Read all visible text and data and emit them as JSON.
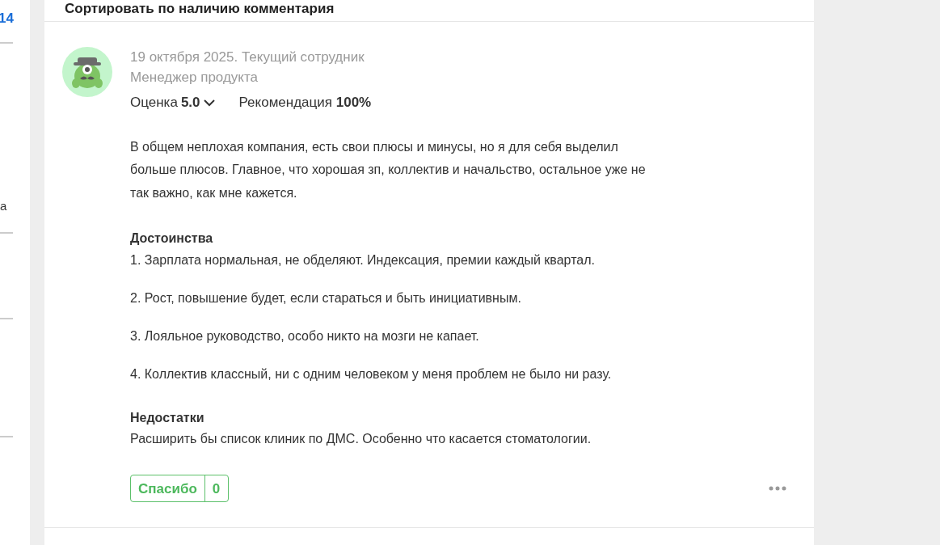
{
  "left_column": {
    "count": "14",
    "fragment": "а"
  },
  "sort": {
    "label": "Сортировать по наличию комментария"
  },
  "review": {
    "date_status": "19 октября 2025. Текущий сотрудник",
    "position": "Менеджер продукта",
    "rating_label": "Оценка",
    "rating": "5.0",
    "recommendation_label": "Рекомендация",
    "recommendation": "100%",
    "summary": "В общем неплохая компания, есть свои плюсы и минусы, но я для себя выделил больше плюсов. Главное, что хорошая зп, коллектив и начальство, остальное уже не так важно, как мне кажется.",
    "sections": [
      {
        "title": "Достоинства",
        "paragraphs": [
          "1. Зарплата нормальная, не обделяют. Индексация, премии каждый квартал.",
          "2. Рост, повышение будет, если стараться и быть инициативным.",
          "3. Лояльное руководство, особо никто на мозги не капает.",
          "4. Коллектив классный, ни с одним человеком у меня проблем не было ни разу."
        ]
      },
      {
        "title": "Недостатки",
        "paragraphs": [
          "Расширить бы список клиник по ДМС. Особенно что касается стоматологии."
        ]
      }
    ],
    "thanks": {
      "label": "Спасибо",
      "count": "0"
    }
  }
}
